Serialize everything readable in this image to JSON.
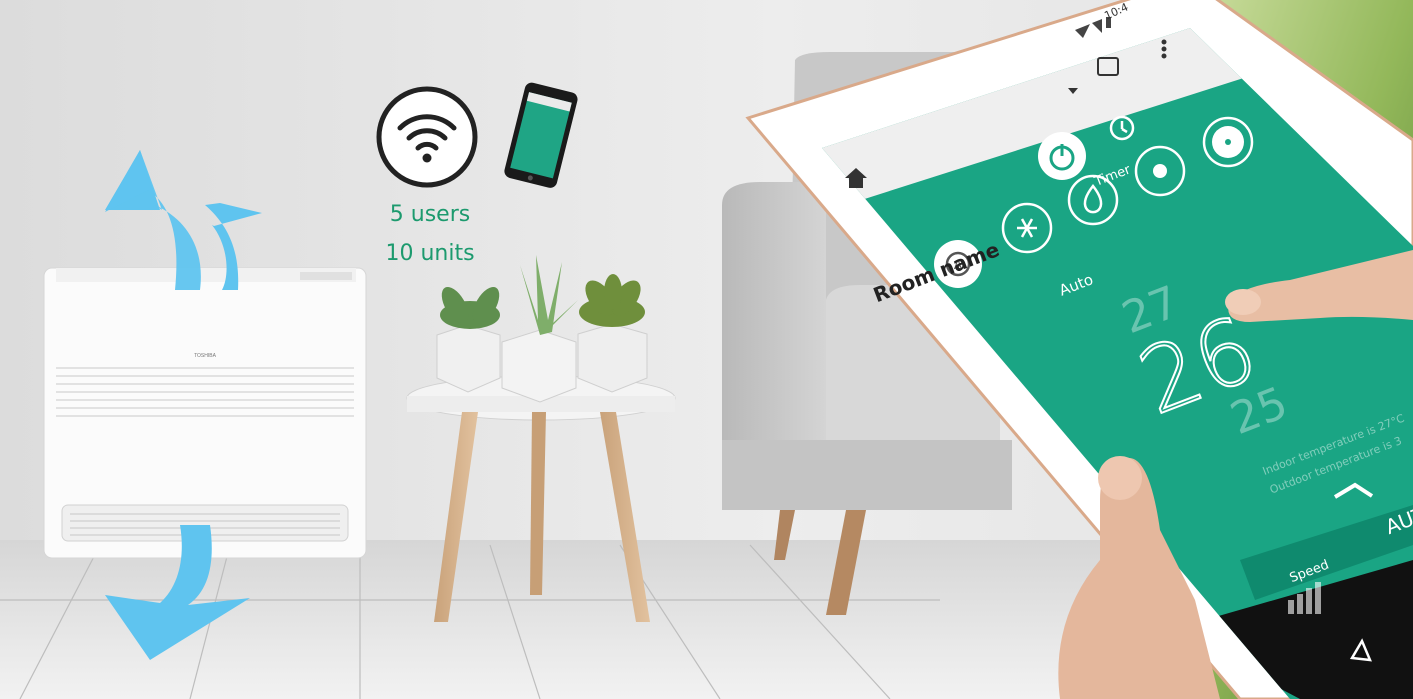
{
  "features": {
    "users": "5 users",
    "units": "10 units"
  },
  "tablet_app": {
    "status_time": "10:4",
    "room_name": "Room name",
    "timer_label": "Timer",
    "mode_label": "Auto",
    "temp_upper": "27",
    "temp_current": "26",
    "temp_lower": "25",
    "indoor_text": "Indoor temperature is 27°C",
    "outdoor_text": "Outdoor temperature is 3",
    "speed_label": "Speed",
    "fan_auto_label": "AUTO"
  },
  "brand": {
    "unit_logo": "TOSHIBA"
  },
  "colors": {
    "app_green": "#1aa584",
    "text_green": "#1c9a6e",
    "arrow_blue": "#5fc4ef"
  },
  "icons": [
    "wifi-icon",
    "smartphone-icon",
    "home-icon",
    "power-icon",
    "timer-icon",
    "auto-mode-icon",
    "snowflake-icon",
    "drop-icon",
    "sun-icon",
    "fan-icon",
    "chevron-up-icon",
    "back-triangle-icon"
  ]
}
